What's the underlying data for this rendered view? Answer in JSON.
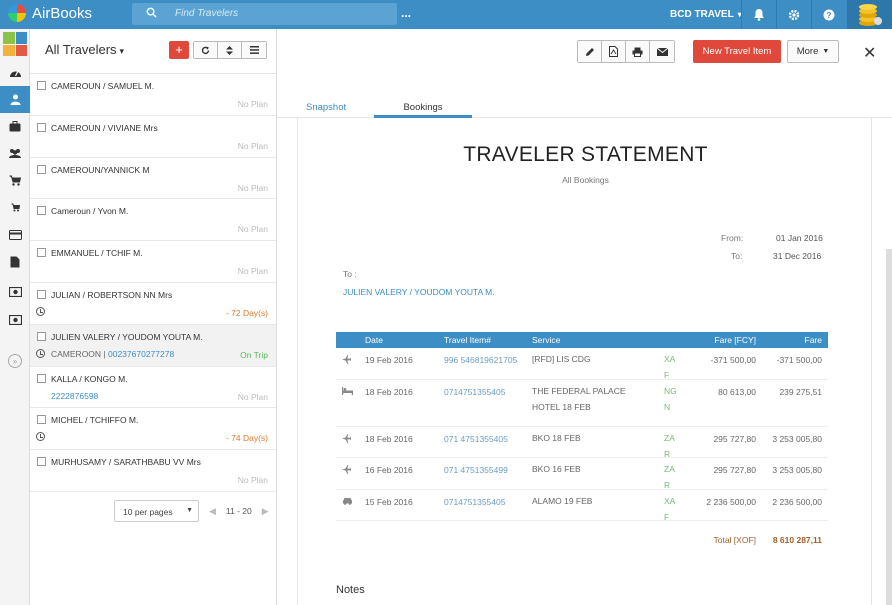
{
  "app": {
    "name": "AirBooks"
  },
  "topbar": {
    "search_placeholder": "Find Travelers",
    "more": "...",
    "agency": "BCD TRAVEL",
    "agency_caret": "▾"
  },
  "list": {
    "title": "All Travelers",
    "title_caret": "▾",
    "add_label": "+",
    "travelers": [
      {
        "name": "CAMEROUN / SAMUEL M.",
        "status": "No Plan",
        "status_type": "none"
      },
      {
        "name": "CAMEROUN / VIVIANE Mrs",
        "status": "No Plan",
        "status_type": "none"
      },
      {
        "name": "CAMEROUN/YANNICK M",
        "status": "No Plan",
        "status_type": "none"
      },
      {
        "name": "Cameroun / Yvon M.",
        "status": "No Plan",
        "status_type": "none"
      },
      {
        "name": "EMMANUEL / TCHIF M.",
        "status": "No Plan",
        "status_type": "none"
      },
      {
        "name": "JULIAN / ROBERTSON NN Mrs",
        "status": "- 72 Day(s)",
        "status_type": "warn",
        "clock": true
      },
      {
        "name": "JULIEN VALERY / YOUDOM YOUTA M.",
        "status": "On Trip",
        "status_type": "ok",
        "clock": true,
        "location": "CAMEROON",
        "phone": "00237670277278",
        "selected": true
      },
      {
        "name": "KALLA / KONGO M.",
        "status": "No Plan",
        "status_type": "none",
        "phone": "2222876598"
      },
      {
        "name": "MICHEL / TCHIFFO M.",
        "status": "- 74 Day(s)",
        "status_type": "warn",
        "clock": true
      },
      {
        "name": "MURHUSAMY / SARATHBABU VV Mrs",
        "status": "No Plan",
        "status_type": "none"
      }
    ],
    "pager": {
      "per_page": "10 per pages",
      "range": "11 - 20"
    }
  },
  "detail": {
    "new_item_label": "New Travel Item",
    "more_label": "More",
    "close_label": "✕",
    "tabs": [
      "Snapshot",
      "Bookings"
    ],
    "statement": {
      "title": "TRAVELER STATEMENT",
      "subtitle": "All Bookings",
      "from_label": "From:",
      "from_value": "01 Jan 2016",
      "to_label": "To:",
      "to_value": "31 Dec 2016",
      "recipient_label": "To :",
      "recipient": "JULIEN VALERY / YOUDOM YOUTA M.",
      "columns": {
        "date": "Date",
        "item": "Travel Item#",
        "service": "Service",
        "fcy": "Fare [FCY]",
        "fare": "Fare"
      },
      "rows": [
        {
          "icon": "plane-icon",
          "date": "19 Feb 2016",
          "item": "996 546819621705",
          "service": "[RFD] LIS CDG",
          "currency": "XAF",
          "fcy": "-371 500,00",
          "fare": "-371 500,00"
        },
        {
          "icon": "bed-icon",
          "date": "18 Feb 2016",
          "item": "0714751355405",
          "service": "THE FEDERAL PALACE HOTEL 18 FEB",
          "currency": "NGN",
          "fcy": "80 613,00",
          "fare": "239 275,51"
        },
        {
          "icon": "plane-icon",
          "date": "18 Feb 2016",
          "item": "071 4751355405",
          "service": "BKO 18 FEB",
          "currency": "ZAR",
          "fcy": "295 727,80",
          "fare": "3 253 005,80"
        },
        {
          "icon": "plane-icon",
          "date": "16 Feb 2016",
          "item": "071 4751355499",
          "service": "BKO 16 FEB",
          "currency": "ZAR",
          "fcy": "295 727,80",
          "fare": "3 253 005,80"
        },
        {
          "icon": "car-icon",
          "date": "15 Feb 2016",
          "item": "0714751355405",
          "service": "ALAMO 19 FEB",
          "currency": "XAF",
          "fcy": "2 236 500,00",
          "fare": "2 236 500,00"
        }
      ],
      "total_label": "Total [XOF]",
      "total_value": "8 610 287,11",
      "notes_label": "Notes"
    }
  },
  "colors": {
    "primary": "#3d8ec4",
    "danger": "#e0483b",
    "warn": "#e07a2c",
    "ok": "#5cb85c"
  }
}
